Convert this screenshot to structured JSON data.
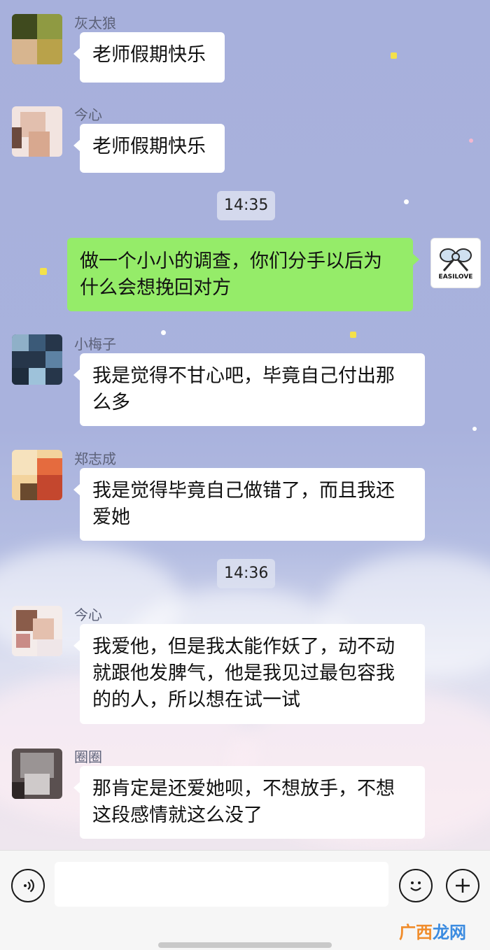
{
  "messages": [
    {
      "sender": "灰太狼",
      "text": "老师假期快乐"
    },
    {
      "sender": "今心",
      "text": "老师假期快乐"
    },
    {
      "timestamp": "14:35"
    },
    {
      "self": true,
      "text": "做一个小小的调查，你们分手以后为什么会想挽回对方",
      "avatar_text": "EASILOVE"
    },
    {
      "sender": "小梅子",
      "text": "我是觉得不甘心吧，毕竟自己付出那么多"
    },
    {
      "sender": "郑志成",
      "text": "我是觉得毕竟自己做错了，而且我还爱她"
    },
    {
      "timestamp": "14:36"
    },
    {
      "sender": "今心",
      "text": "我爱他，但是我太能作妖了，动不动就跟他发脾气，他是我见过最包容我的的人，所以想在试一试"
    },
    {
      "sender": "圈圈",
      "text": "那肯定是还爱她呗，不想放手，不想这段感情就这么没了"
    }
  ],
  "input_bar": {
    "voice_icon": "voice-icon",
    "emoji_icon": "emoji-icon",
    "plus_icon": "plus-icon",
    "text": ""
  },
  "watermark": {
    "part1": "广西",
    "part2": "龙网"
  },
  "colors": {
    "self_bubble": "#95ec69",
    "other_bubble": "#ffffff",
    "background": "#a9b2dd"
  }
}
